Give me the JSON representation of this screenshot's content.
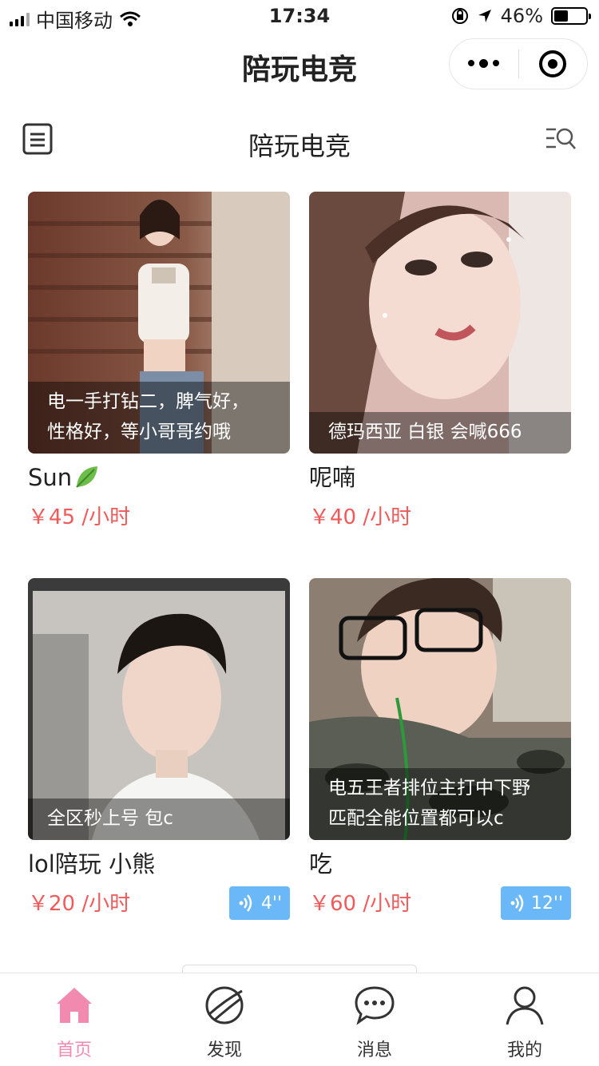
{
  "status_bar": {
    "carrier": "中国移动",
    "time": "17:34",
    "battery": "46%",
    "battery_level": 0.46
  },
  "navbar": {
    "title": "陪玩电竞"
  },
  "header": {
    "title": "陪玩电竞"
  },
  "cards": [
    {
      "caption_line1": "电一手打钻二，脾气好，",
      "caption_line2": "性格好，等小哥哥约哦",
      "name": "Sun",
      "price": "￥45 /小时",
      "voice": ""
    },
    {
      "caption_line1": "德玛西亚 白银 会喊666",
      "caption_line2": "",
      "name": "呢喃",
      "price": "￥40 /小时",
      "voice": ""
    },
    {
      "caption_line1": "全区秒上号 包c",
      "caption_line2": "",
      "name": "lol陪玩 小熊",
      "price": "￥20 /小时",
      "voice": "4''"
    },
    {
      "caption_line1": "电五王者排位主打中下野",
      "caption_line2": "匹配全能位置都可以c",
      "name": "吃",
      "price": "￥60 /小时",
      "voice": "12''"
    }
  ],
  "tabbar": [
    {
      "label": "首页",
      "icon": "home-icon",
      "active": true
    },
    {
      "label": "发现",
      "icon": "planet-icon",
      "active": false
    },
    {
      "label": "消息",
      "icon": "chat-bubble-icon",
      "active": false
    },
    {
      "label": "我的",
      "icon": "user-icon",
      "active": false
    }
  ],
  "colors": {
    "price": "#f25a5a",
    "active_tab": "#f28aaf",
    "voice_badge": "#6ab8f7"
  }
}
